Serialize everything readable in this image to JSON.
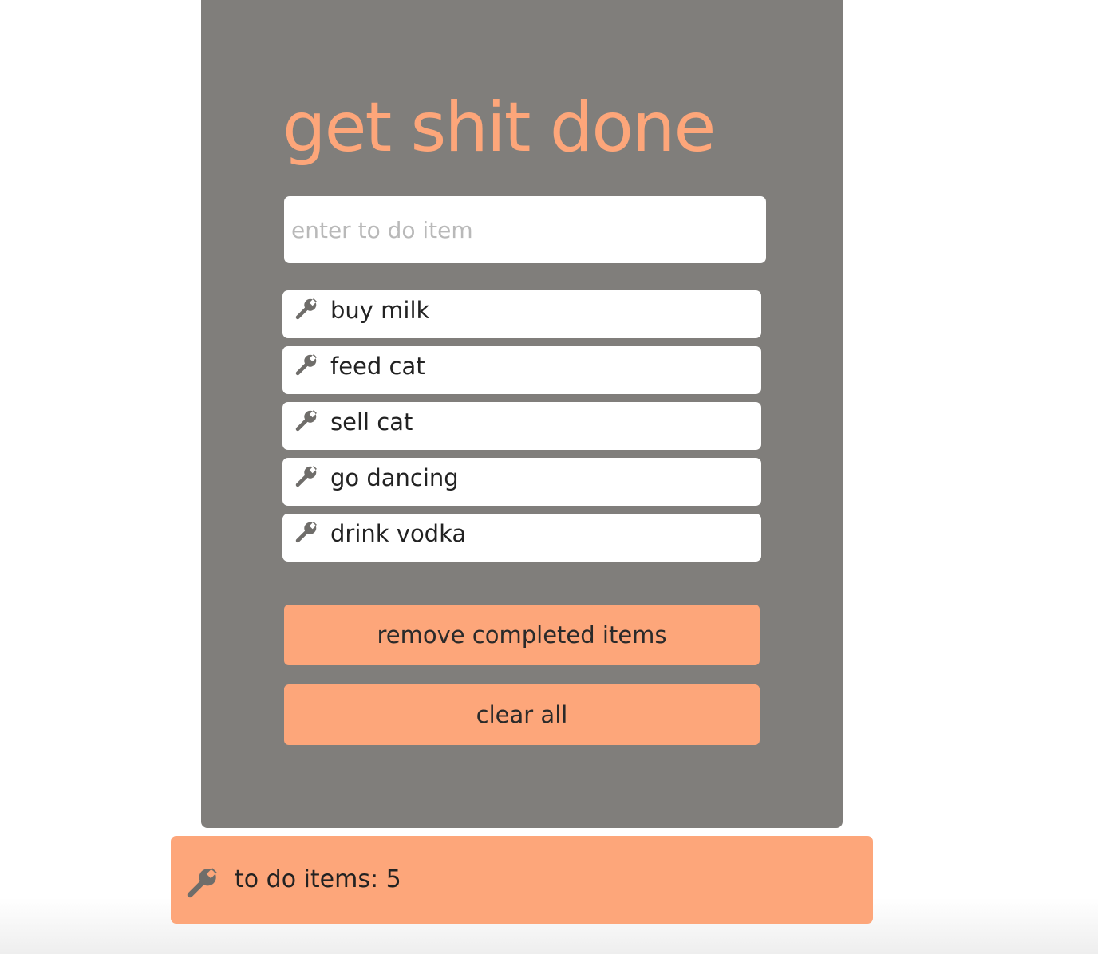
{
  "app": {
    "title": "get shit done"
  },
  "input": {
    "placeholder": "enter to do item",
    "value": ""
  },
  "todo_items": [
    {
      "label": "buy milk",
      "icon": "wrench-icon"
    },
    {
      "label": "feed cat",
      "icon": "wrench-icon"
    },
    {
      "label": "sell cat",
      "icon": "wrench-icon"
    },
    {
      "label": "go dancing",
      "icon": "wrench-icon"
    },
    {
      "label": "drink vodka",
      "icon": "wrench-icon"
    }
  ],
  "buttons": {
    "remove_completed": "remove completed items",
    "clear_all": "clear all"
  },
  "footer": {
    "icon": "wrench-icon",
    "count_text": "to do items: 5"
  },
  "colors": {
    "panel_background": "#807e7b",
    "accent": "#fda67a",
    "item_background": "#ffffff",
    "icon": "#6f6d6a"
  }
}
